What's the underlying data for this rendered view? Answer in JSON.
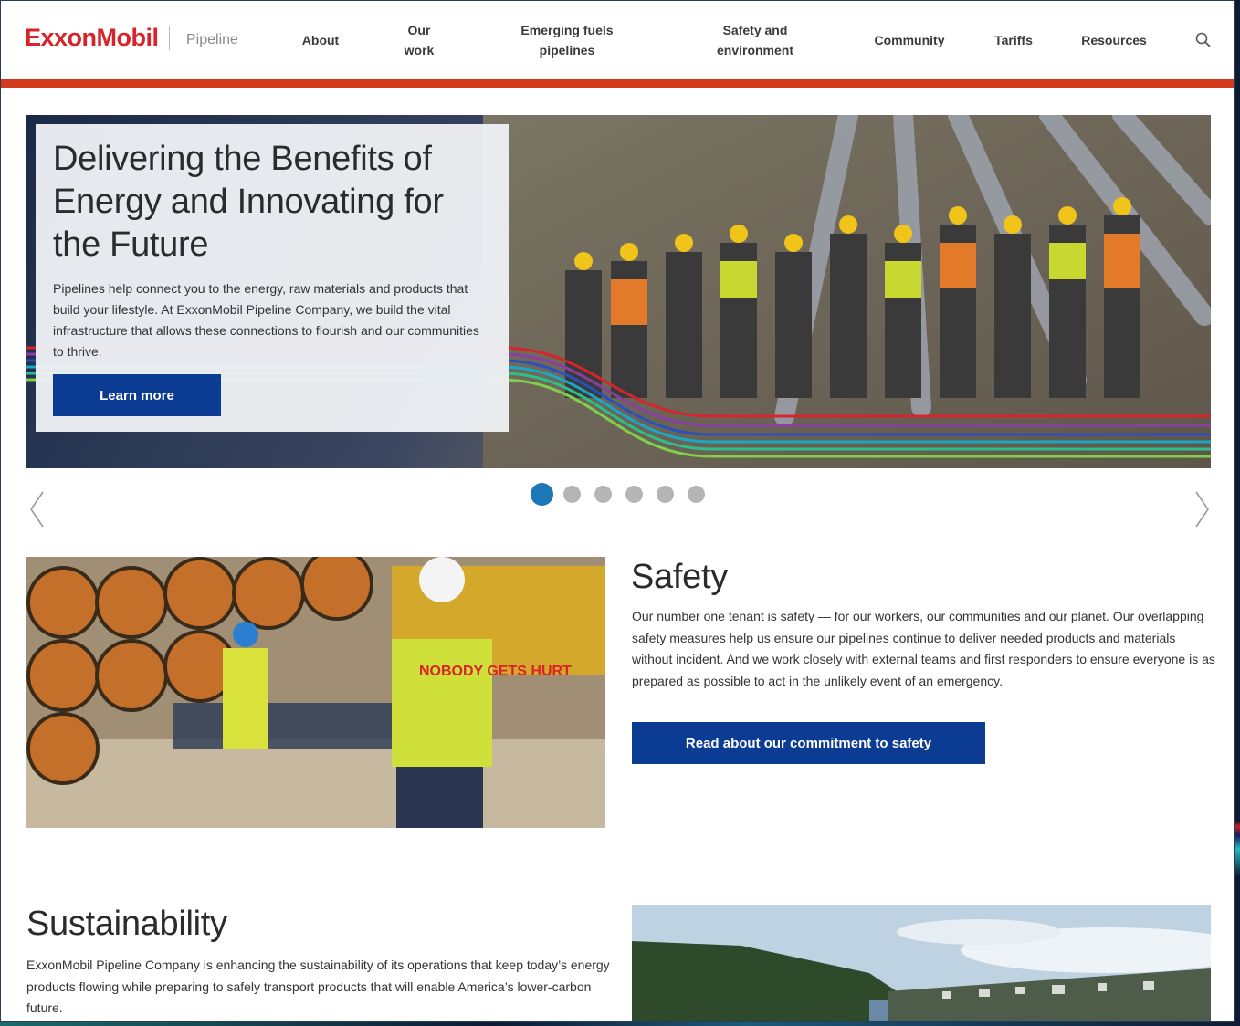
{
  "header": {
    "logo": "ExxonMobil",
    "logo_sub": "Pipeline",
    "nav": [
      {
        "label": "About"
      },
      {
        "label": "Our work"
      },
      {
        "label": "Emerging fuels pipelines"
      },
      {
        "label": "Safety and environment"
      },
      {
        "label": "Community"
      },
      {
        "label": "Tariffs"
      },
      {
        "label": "Resources"
      }
    ],
    "search_icon": "search-icon"
  },
  "hero": {
    "title": "Delivering the Benefits of Energy and Innovating for the Future",
    "text": "Pipelines help connect you to the energy, raw materials and products that build your lifestyle. At ExxonMobil Pipeline Company, we build the vital infrastructure that allows these connections to flourish and our communities to thrive.",
    "button": "Learn more"
  },
  "carousel": {
    "slide_count": 6,
    "active_slide": 1,
    "prev_icon": "chevron-left-icon",
    "next_icon": "chevron-right-icon"
  },
  "safety": {
    "title": "Safety",
    "text": "Our number one tenant is safety — for our workers, our communities and our planet. Our overlapping safety measures help us ensure our pipelines continue to deliver needed products and materials without incident. And we work closely with external teams and first responders to ensure everyone is as prepared as possible to act in the unlikely event of an emergency.",
    "button": "Read about our commitment to safety",
    "vest_text": "NOBODY GETS HURT"
  },
  "sustainability": {
    "title": "Sustainability",
    "text": "ExxonMobil Pipeline Company is enhancing the sustainability of its operations that keep today’s energy products flowing while preparing to safely transport products that will enable America’s lower-carbon future."
  },
  "colors": {
    "brand_red": "#d8232a",
    "accent_bar": "#d2381c",
    "button_blue": "#0c3b93",
    "dot_active": "#1b77b6"
  }
}
